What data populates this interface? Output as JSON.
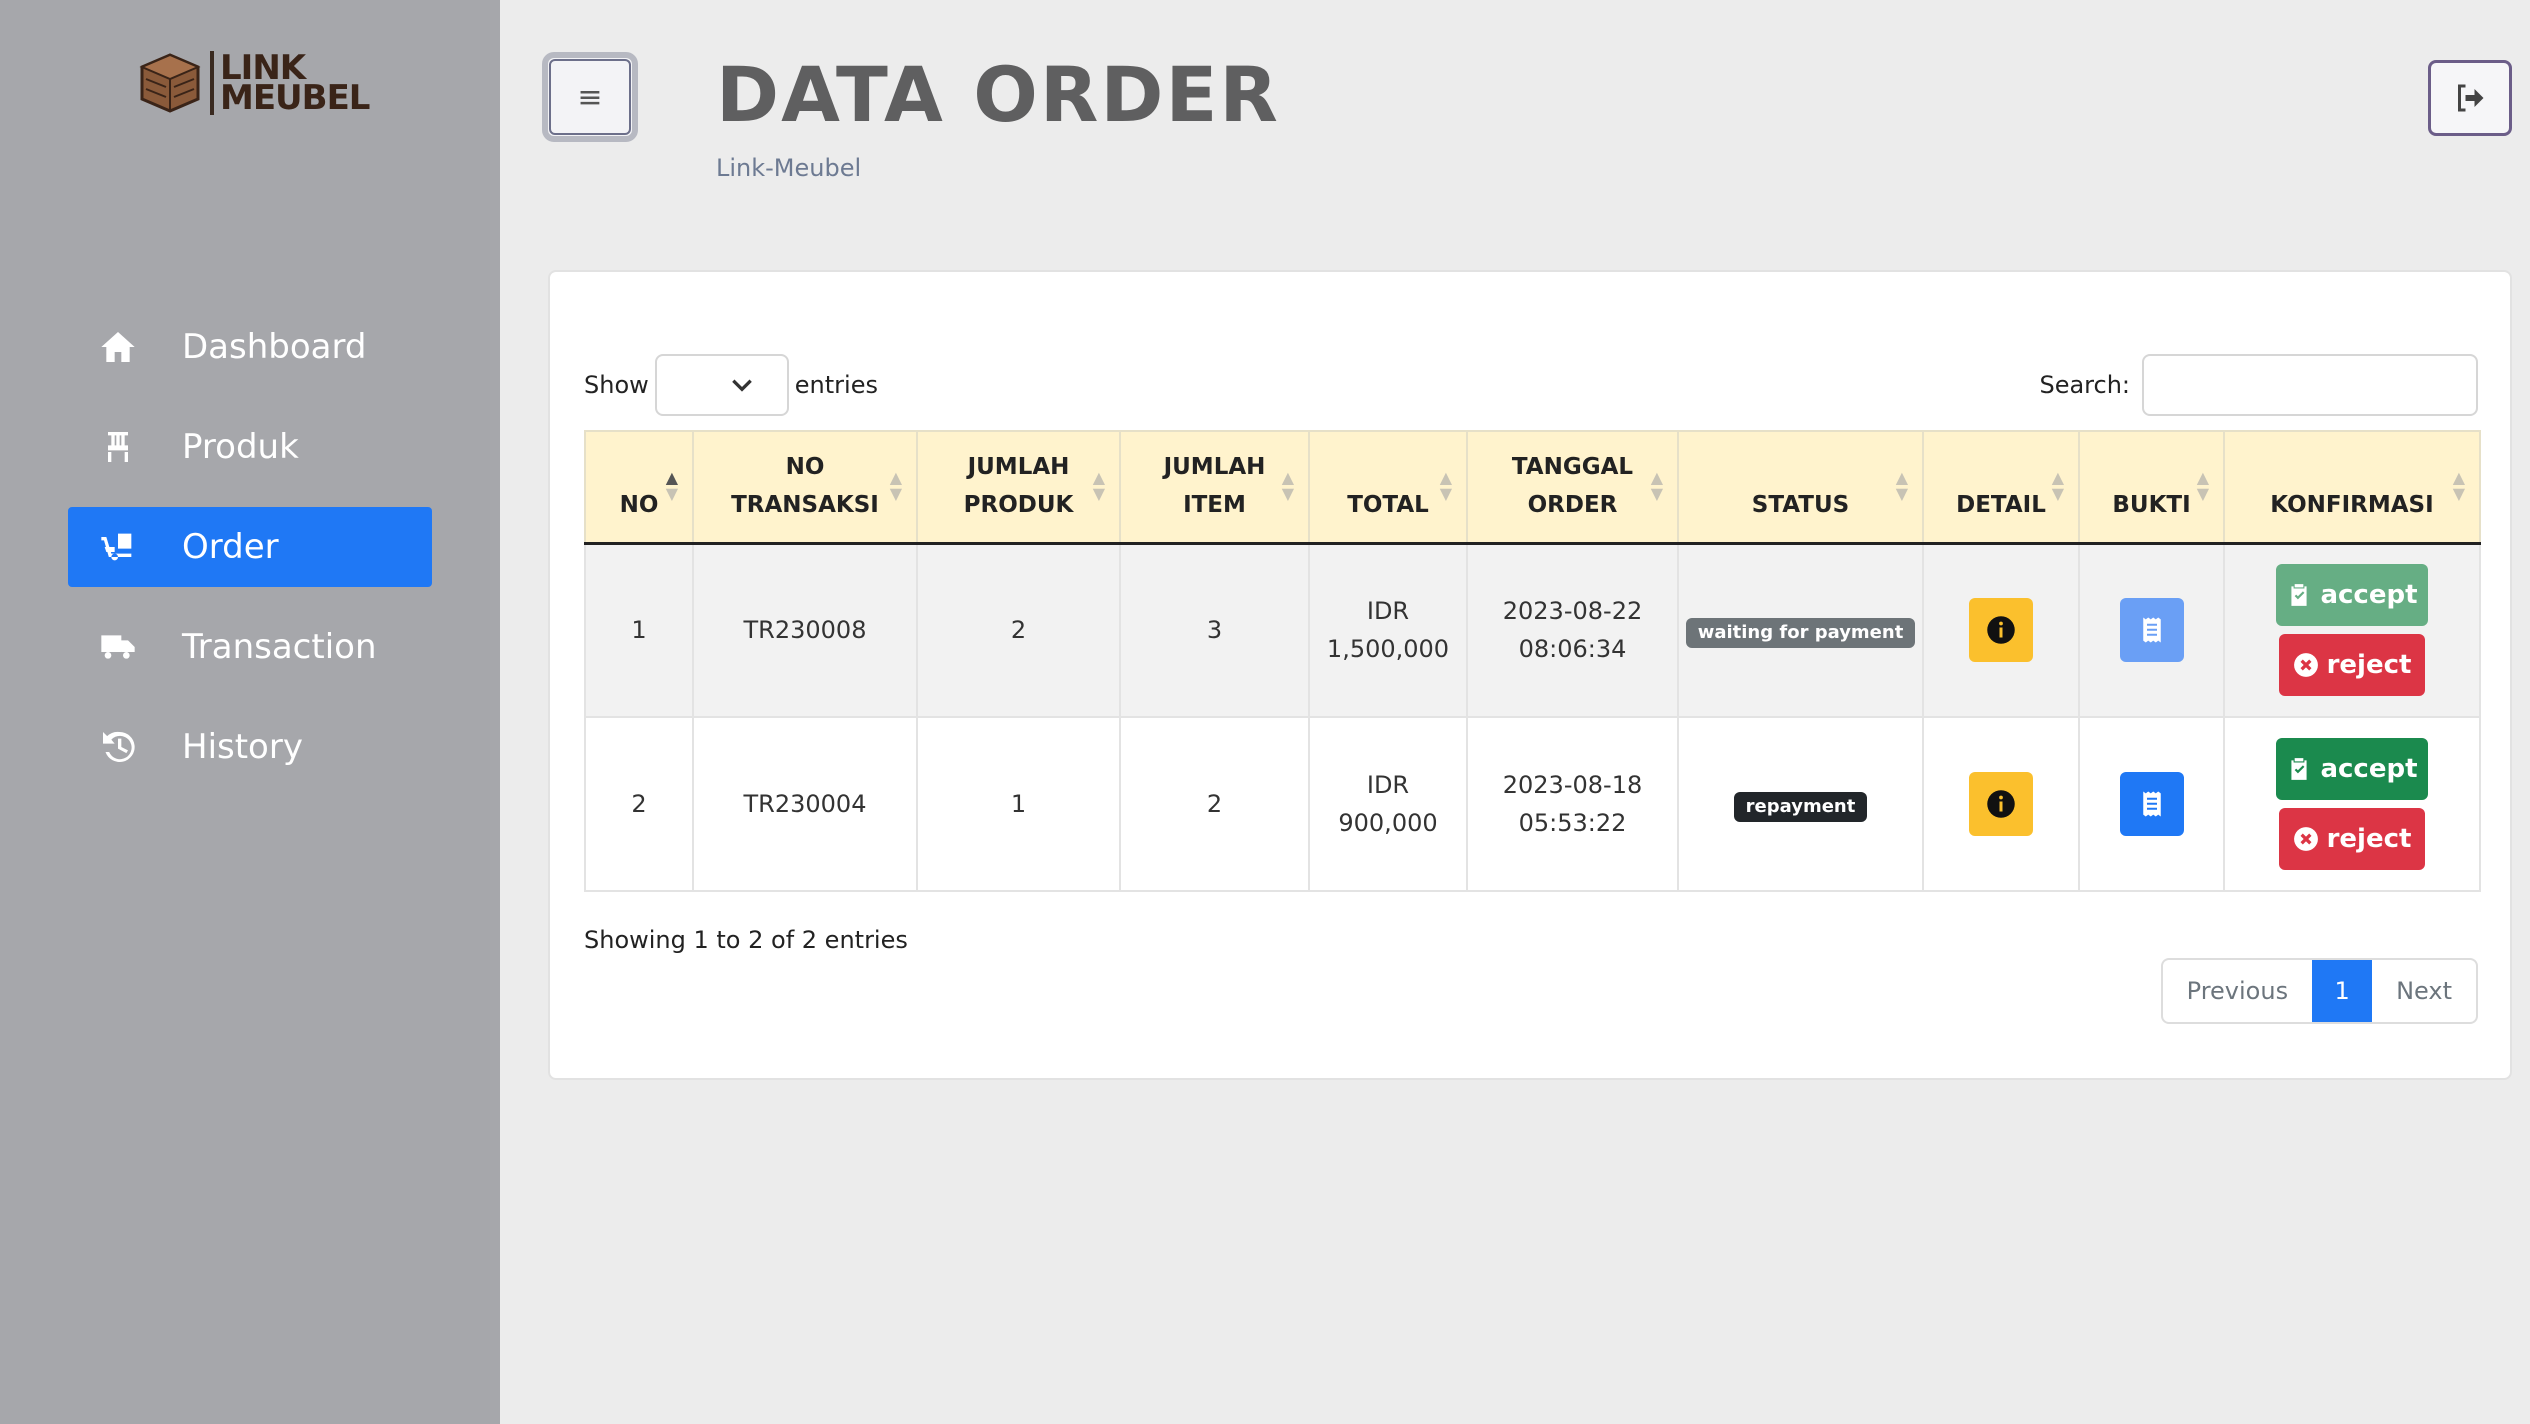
{
  "brand": {
    "line1": "LINK",
    "line2": "MEUBEL"
  },
  "sidebar": {
    "items": [
      {
        "label": "Dashboard",
        "icon": "home-icon",
        "active": false
      },
      {
        "label": "Produk",
        "icon": "chair-icon",
        "active": false
      },
      {
        "label": "Order",
        "icon": "dolly-icon",
        "active": true
      },
      {
        "label": "Transaction",
        "icon": "truck-icon",
        "active": false
      },
      {
        "label": "History",
        "icon": "history-icon",
        "active": false
      }
    ]
  },
  "header": {
    "title": "DATA ORDER",
    "subtitle": "Link-Meubel",
    "toggle_icon": "≡"
  },
  "controls": {
    "show_label": "Show",
    "entries_label": "entries",
    "search_label": "Search:"
  },
  "table": {
    "columns": [
      {
        "l1": "",
        "l2": "NO"
      },
      {
        "l1": "NO",
        "l2": "TRANSAKSI"
      },
      {
        "l1": "JUMLAH",
        "l2": "PRODUK"
      },
      {
        "l1": "JUMLAH",
        "l2": "ITEM"
      },
      {
        "l1": "",
        "l2": "TOTAL"
      },
      {
        "l1": "TANGGAL",
        "l2": "ORDER"
      },
      {
        "l1": "",
        "l2": "STATUS"
      },
      {
        "l1": "",
        "l2": "DETAIL"
      },
      {
        "l1": "",
        "l2": "BUKTI"
      },
      {
        "l1": "",
        "l2": "KONFIRMASI"
      }
    ],
    "rows": [
      {
        "no": "1",
        "transaksi": "TR230008",
        "produk": "2",
        "item": "3",
        "total_l1": "IDR",
        "total_l2": "1,500,000",
        "date": "2023-08-22",
        "time": "08:06:34",
        "status": "waiting for payment",
        "accept": "accept",
        "reject": "reject"
      },
      {
        "no": "2",
        "transaksi": "TR230004",
        "produk": "1",
        "item": "2",
        "total_l1": "IDR",
        "total_l2": "900,000",
        "date": "2023-08-18",
        "time": "05:53:22",
        "status": "repayment",
        "accept": "accept",
        "reject": "reject"
      }
    ]
  },
  "footer": {
    "info": "Showing 1 to 2 of 2 entries",
    "prev": "Previous",
    "page": "1",
    "next": "Next"
  },
  "colors": {
    "accent": "#1f78f5",
    "sidebar": "#a6a7ab",
    "header_row": "#fff3cd",
    "accept": "#1b8a4e",
    "reject": "#dc3545",
    "detail": "#fbc02d"
  }
}
